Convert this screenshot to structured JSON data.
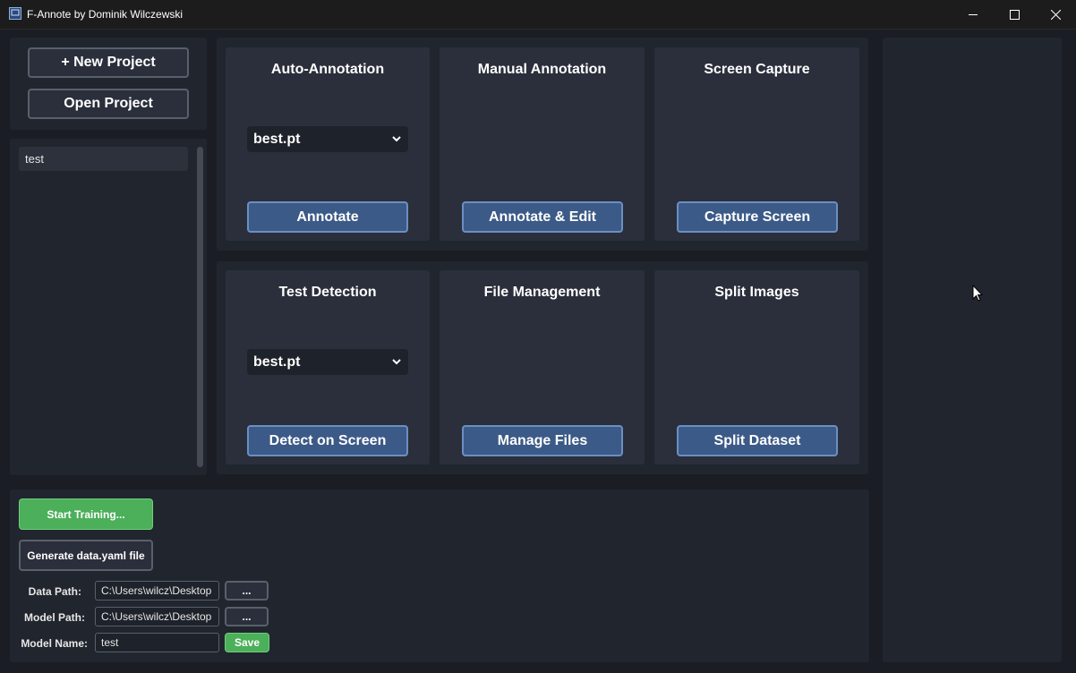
{
  "window": {
    "title": "F-Annote by Dominik Wilczewski"
  },
  "sidebar": {
    "new_project_label": "+  New Project",
    "open_project_label": "Open Project",
    "projects": [
      "test"
    ]
  },
  "cards": {
    "auto_annotation": {
      "title": "Auto-Annotation",
      "model": "best.pt",
      "button": "Annotate"
    },
    "manual_annotation": {
      "title": "Manual Annotation",
      "button": "Annotate & Edit"
    },
    "screen_capture": {
      "title": "Screen Capture",
      "button": "Capture Screen"
    },
    "test_detection": {
      "title": "Test Detection",
      "model": "best.pt",
      "button": "Detect on Screen"
    },
    "file_management": {
      "title": "File Management",
      "button": "Manage Files"
    },
    "split_images": {
      "title": "Split Images",
      "button": "Split Dataset"
    }
  },
  "training": {
    "start_label": "Start Training...",
    "generate_label": "Generate data.yaml file",
    "data_path_label": "Data Path:",
    "data_path_value": "C:\\Users\\wilcz\\Desktop",
    "model_path_label": "Model Path:",
    "model_path_value": "C:\\Users\\wilcz\\Desktop",
    "model_name_label": "Model Name:",
    "model_name_value": "test",
    "browse_label": "...",
    "save_label": "Save"
  },
  "colors": {
    "accent_blue": "#3c5a87",
    "accent_green": "#4caf5a",
    "panel": "#21252e",
    "card": "#2a2f3b"
  }
}
